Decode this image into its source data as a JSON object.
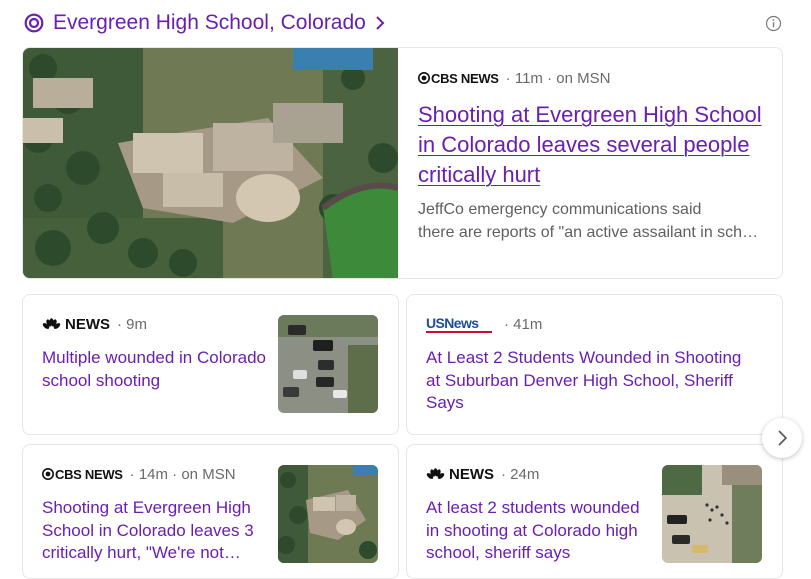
{
  "header": {
    "title": "Evergreen High School, Colorado"
  },
  "colors": {
    "accent": "#6a1fb0",
    "meta": "#6a6a6a",
    "snippet": "#5f5f5f",
    "card_border": "#e6e6e6"
  },
  "icons": {
    "topic": "topic-rings-icon",
    "more": "chevron-right-icon",
    "info": "info-icon",
    "next": "carousel-next-icon"
  },
  "lead": {
    "source": "CBS NEWS",
    "time": "· 11m · on MSN",
    "title": "Shooting at Evergreen High School in Colorado leaves several people critically hurt",
    "snippet_lines": [
      "JeffCo emergency communications said",
      "there are reports of \"an active assailant in school\"..."
    ]
  },
  "cards": [
    {
      "source": "NEWS",
      "time": "· 9m",
      "title": "Multiple wounded in Colorado school shooting"
    },
    {
      "source": "USNews",
      "time": "· 41m",
      "title": "At Least 2 Students Wounded in Shooting at Suburban Denver High School, Sheriff Says"
    },
    {
      "source": "CBS NEWS",
      "time": "· 14m · on MSN",
      "title": "Shooting at Evergreen High School in Colorado leaves 3 critically hurt, \"We're not...",
      "title_lines": [
        "Shooting at Evergreen High",
        "School in Colorado leaves 3",
        "critically hurt, \"We're not…"
      ]
    },
    {
      "source": "NEWS",
      "time": "· 24m",
      "title": "At least 2 students wounded in shooting at Colorado high school, sheriff says"
    }
  ]
}
